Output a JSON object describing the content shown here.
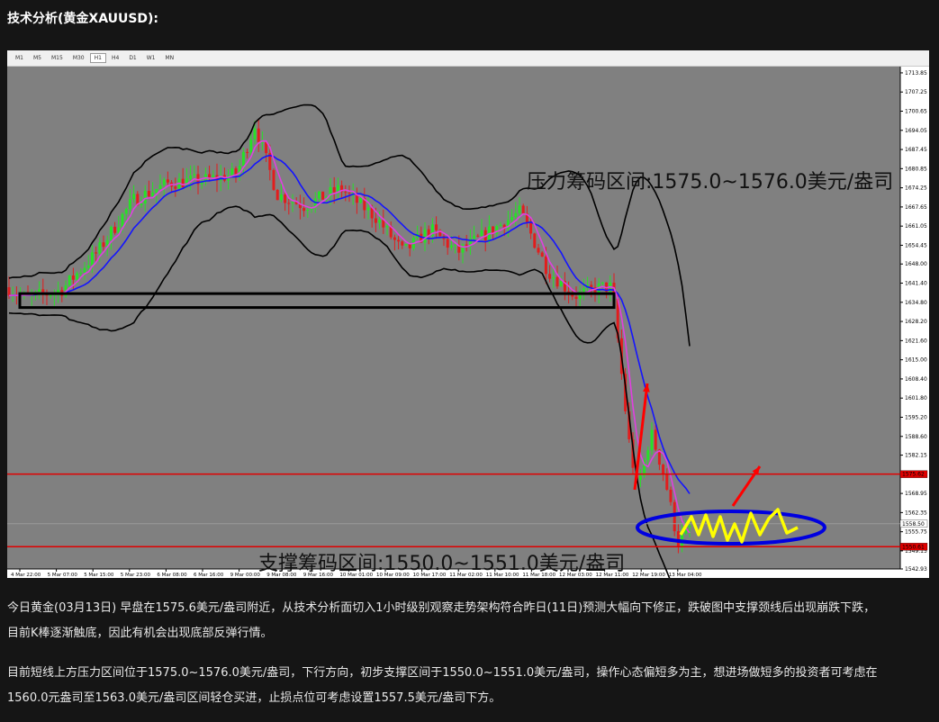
{
  "heading": "技术分析(黄金XAUUSD):",
  "timeframes": [
    {
      "label": "M1",
      "active": false
    },
    {
      "label": "M5",
      "active": false
    },
    {
      "label": "M15",
      "active": false
    },
    {
      "label": "M30",
      "active": false
    },
    {
      "label": "H1",
      "active": true
    },
    {
      "label": "H4",
      "active": false
    },
    {
      "label": "D1",
      "active": false
    },
    {
      "label": "W1",
      "active": false
    },
    {
      "label": "MN",
      "active": false
    }
  ],
  "chart_data": {
    "type": "candlestick",
    "instrument": "XAUUSD",
    "timeframe": "H1",
    "ylim": [
      1542.93,
      1716.0
    ],
    "y_ticks": [
      "1713.85",
      "1707.25",
      "1700.65",
      "1694.05",
      "1687.45",
      "1680.85",
      "1674.25",
      "1667.65",
      "1661.05",
      "1654.45",
      "1648.00",
      "1641.40",
      "1634.80",
      "1628.20",
      "1621.60",
      "1615.00",
      "1608.40",
      "1601.80",
      "1595.20",
      "1588.60",
      "1582.15",
      "1575.55",
      "1568.95",
      "1562.35",
      "1555.75",
      "1549.15",
      "1542.93"
    ],
    "x_ticks": [
      "4 Mar 22:00",
      "5 Mar 07:00",
      "5 Mar 15:00",
      "5 Mar 23:00",
      "6 Mar 08:00",
      "6 Mar 16:00",
      "9 Mar 00:00",
      "9 Mar 08:00",
      "9 Mar 16:00",
      "10 Mar 01:00",
      "10 Mar 09:00",
      "10 Mar 17:00",
      "11 Mar 02:00",
      "11 Mar 10:00",
      "11 Mar 18:00",
      "12 Mar 03:00",
      "12 Mar 11:00",
      "12 Mar 19:00",
      "13 Mar 04:00"
    ],
    "price_labels": {
      "resistance_line": "1575.62",
      "current": "1558.50",
      "support_line": "1550.61"
    },
    "resistance_annotation": "压力筹码区间:1575.0~1576.0美元/盎司",
    "support_annotation": "支撑筹码区间:1550.0~1551.0美元/盎司",
    "horizontal_lines": [
      1575.6,
      1550.6
    ],
    "consolidation_box": [
      1633.0,
      1637.8
    ],
    "colors": {
      "up": "#28e028",
      "down": "#e21d1d",
      "ma_fast": "#e040e0",
      "ma_slow": "#1414ff",
      "bands": "#000000",
      "level": "#e00000",
      "arrow": "#ff0000",
      "scenario": "#ffff00",
      "ellipse": "#0000e0",
      "bg": "#808080"
    }
  },
  "paragraphs": [
    "今日黄金(03月13日) 早盘在1575.6美元/盎司附近，从技术分析面切入1小时级别观察走势架构符合昨日(11日)预测大幅向下修正，跌破图中支撑颈线后出现崩跌下跌，",
    "目前K棒逐渐触底，因此有机会出现底部反弹行情。",
    "目前短线上方压力区间位于1575.0~1576.0美元/盎司，下行方向，初步支撑区间于1550.0~1551.0美元/盎司，操作心态偏短多为主，想进场做短多的投资者可考虑在",
    "1560.0元盎司至1563.0美元/盎司区间轻仓买进，止损点位可考虑设置1557.5美元/盎司下方。"
  ]
}
